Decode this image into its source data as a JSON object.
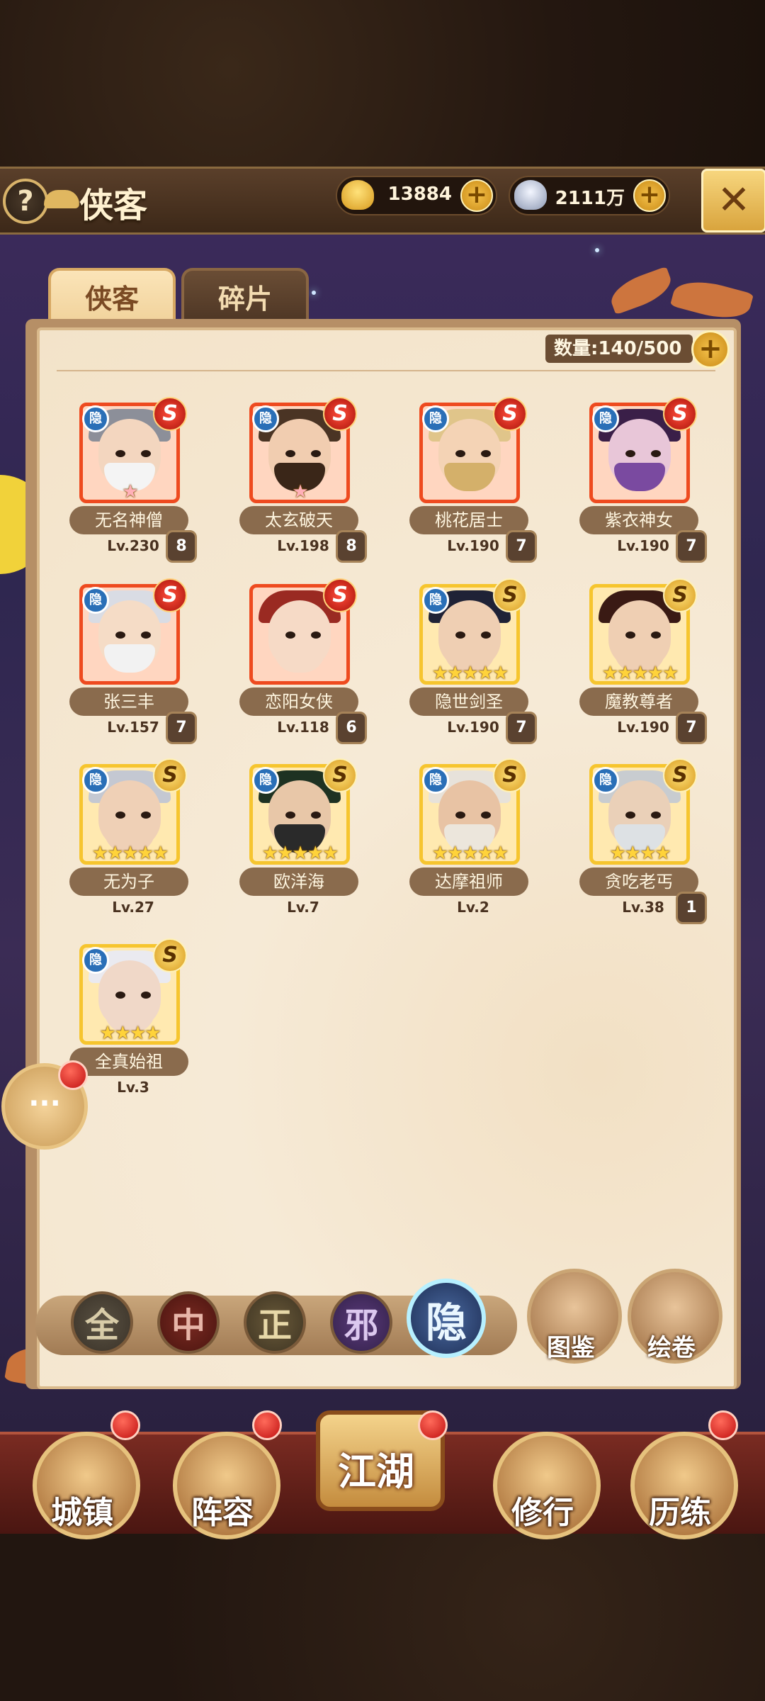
{
  "header": {
    "title": "侠客",
    "help_label": "?",
    "gold_amount": "13884",
    "silver_amount": "2111万",
    "plus_label": "+",
    "close_label": "✕"
  },
  "tabs": [
    {
      "label": "侠客",
      "active": true
    },
    {
      "label": "碎片",
      "active": false
    }
  ],
  "inventory": {
    "count_label": "数量:140/500"
  },
  "heroes": [
    {
      "name": "无名神僧",
      "level": "Lv.230",
      "rank": "8",
      "tier": "red",
      "stars": "★",
      "tag": "隐",
      "grade": "S"
    },
    {
      "name": "太玄破天",
      "level": "Lv.198",
      "rank": "8",
      "tier": "red",
      "stars": "★",
      "tag": "隐",
      "grade": "S"
    },
    {
      "name": "桃花居士",
      "level": "Lv.190",
      "rank": "7",
      "tier": "red",
      "stars": "",
      "tag": "隐",
      "grade": "S"
    },
    {
      "name": "紫衣神女",
      "level": "Lv.190",
      "rank": "7",
      "tier": "red",
      "stars": "",
      "tag": "隐",
      "grade": "S"
    },
    {
      "name": "张三丰",
      "level": "Lv.157",
      "rank": "7",
      "tier": "red",
      "stars": "",
      "tag": "隐",
      "grade": "S"
    },
    {
      "name": "恋阳女侠",
      "level": "Lv.118",
      "rank": "6",
      "tier": "red",
      "stars": "",
      "tag": "",
      "grade": "S"
    },
    {
      "name": "隐世剑圣",
      "level": "Lv.190",
      "rank": "7",
      "tier": "gold",
      "stars": "★★★★★",
      "tag": "隐",
      "grade": "S"
    },
    {
      "name": "魔教尊者",
      "level": "Lv.190",
      "rank": "7",
      "tier": "gold",
      "stars": "★★★★★",
      "tag": "",
      "grade": "S"
    },
    {
      "name": "无为子",
      "level": "Lv.27",
      "rank": "",
      "tier": "gold",
      "stars": "★★★★★",
      "tag": "隐",
      "grade": "S"
    },
    {
      "name": "欧洋海",
      "level": "Lv.7",
      "rank": "",
      "tier": "gold",
      "stars": "★★★★★",
      "tag": "隐",
      "grade": "S"
    },
    {
      "name": "达摩祖师",
      "level": "Lv.2",
      "rank": "",
      "tier": "gold",
      "stars": "★★★★★",
      "tag": "隐",
      "grade": "S"
    },
    {
      "name": "贪吃老丐",
      "level": "Lv.38",
      "rank": "1",
      "tier": "gold",
      "stars": "★★★★",
      "tag": "隐",
      "grade": "S"
    },
    {
      "name": "全真始祖",
      "level": "Lv.3",
      "rank": "",
      "tier": "gold",
      "stars": "★★★★",
      "tag": "隐",
      "grade": "S"
    }
  ],
  "filters": [
    "全",
    "中",
    "正",
    "邪",
    "隐"
  ],
  "side_buttons": {
    "codex": "图鉴",
    "scroll": "绘卷"
  },
  "nav": {
    "town": "城镇",
    "lineup": "阵容",
    "jianghu": "江湖",
    "practice": "修行",
    "trial": "历练"
  },
  "chat_label": "···",
  "colors": {
    "red_tier": "#ee4a1f",
    "gold_tier": "#f6c52e",
    "panel_bg": "#f6ead6",
    "nav_bg": "#7a2b22"
  }
}
